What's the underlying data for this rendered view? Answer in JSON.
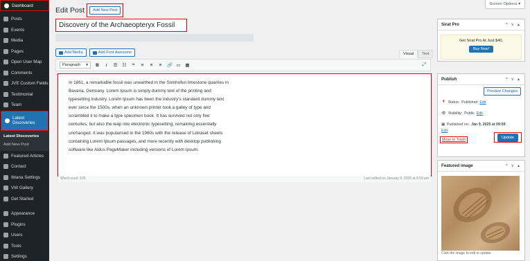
{
  "sidebar": {
    "dashboard": "Dashboard",
    "items": [
      {
        "label": "Posts",
        "icon": "pin-icon"
      },
      {
        "label": "Events",
        "icon": "calendar-icon"
      },
      {
        "label": "Media",
        "icon": "media-icon"
      },
      {
        "label": "Pages",
        "icon": "page-icon"
      },
      {
        "label": "Open User Map",
        "icon": "map-icon"
      },
      {
        "label": "Comments",
        "icon": "comment-icon"
      },
      {
        "label": "JVE Custom Fields",
        "icon": "fields-icon"
      },
      {
        "label": "Testimonial",
        "icon": "testimonial-icon"
      },
      {
        "label": "Team",
        "icon": "team-icon"
      }
    ],
    "active": {
      "line1": "Latest",
      "line2": "Discoveries"
    },
    "submenu": [
      "Latest Discoveries",
      "Add New Post"
    ],
    "items2": [
      {
        "label": "Featured Articles",
        "icon": "article-icon"
      },
      {
        "label": "Contact",
        "icon": "mail-icon"
      },
      {
        "label": "Ibtana Settings",
        "icon": "settings-icon"
      },
      {
        "label": "VW Gallery",
        "icon": "gallery-icon"
      },
      {
        "label": "Get Started",
        "icon": "chevron-icon"
      }
    ],
    "items3": [
      {
        "label": "Appearance",
        "icon": "brush-icon"
      },
      {
        "label": "Plugins",
        "icon": "plugin-icon"
      },
      {
        "label": "Users",
        "icon": "user-icon"
      },
      {
        "label": "Tools",
        "icon": "wrench-icon"
      },
      {
        "label": "Settings",
        "icon": "sliders-icon"
      }
    ]
  },
  "header": {
    "title": "Edit Post",
    "add_new": "Add New Post",
    "screen_options": "Screen Options ▾"
  },
  "post": {
    "title": "Discovery of the Archaeopteryx Fossil",
    "add_media": "Add Media",
    "add_font": "Add Font Awesome",
    "tab_visual": "Visual",
    "tab_text": "Text",
    "format": "Paragraph",
    "body_lines": [
      "In 1861, a remarkable fossil was unearthed in the Solnhofen limestone quarries in",
      "Bavaria, Germany. Lorem Ipsum is simply dummy text of the printing and",
      "typesetting industry. Lorem Ipsum has been the industry's standard dummy text",
      "ever since the 1500s, when an unknown printer took a galley of type and",
      "scrambled it to make a type specimen book. It has survived not only five",
      "centuries, but also the leap into electronic typesetting, remaining essentially",
      "unchanged. It was popularised in the 1960s with the release of Letraset sheets",
      "containing Lorem Ipsum passages, and more recently with desktop publishing",
      "software like Aldus PageMaker including versions of Lorem Ipsum."
    ],
    "word_count": "Word count: 105",
    "last_edited": "Last edited on January 9, 2025 at 9:59 am"
  },
  "sirat": {
    "title": "Sirat Pro",
    "promo": "Get Sirat Pro At Just $40.",
    "buy": "Buy Now!"
  },
  "publish": {
    "title": "Publish",
    "preview": "Preview Changes",
    "status_label": "Status:",
    "status_value": "Published",
    "visibility_label": "Visibility:",
    "visibility_value": "Public",
    "published_label": "Published on:",
    "published_value": "Jan 9, 2025 at 09:59",
    "edit": "Edit",
    "trash": "Move to Trash",
    "update": "Update"
  },
  "featured": {
    "title": "Featured image",
    "caption": "Click the image to edit or update"
  },
  "colors": {
    "accent": "#2271b1",
    "sidebar": "#1d2327",
    "highlight": "#e00000"
  }
}
